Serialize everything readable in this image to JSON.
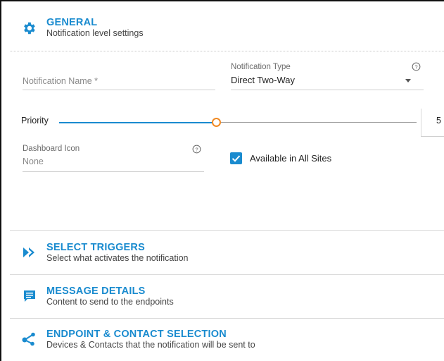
{
  "general": {
    "title": "GENERAL",
    "subtitle": "Notification level settings",
    "icon": "gear-icon"
  },
  "form": {
    "notification_name": {
      "placeholder": "Notification Name *",
      "value": ""
    },
    "notification_type": {
      "label": "Notification Type",
      "value": "Direct Two-Way"
    },
    "priority": {
      "label": "Priority",
      "value": 5,
      "display": "5"
    },
    "dashboard_icon": {
      "label": "Dashboard Icon",
      "value": "None"
    },
    "available_all_sites": {
      "label": "Available in All Sites",
      "checked": true
    }
  },
  "sections": [
    {
      "title": "SELECT TRIGGERS",
      "subtitle": "Select what activates the notification",
      "icon": "double-chevron-right-icon"
    },
    {
      "title": "MESSAGE DETAILS",
      "subtitle": "Content to send to the endpoints",
      "icon": "message-icon"
    },
    {
      "title": "ENDPOINT & CONTACT SELECTION",
      "subtitle": "Devices & Contacts that the notification will be sent to",
      "icon": "share-icon"
    }
  ],
  "colors": {
    "accent": "#1a8bcf",
    "slider_thumb": "#f08a24"
  }
}
